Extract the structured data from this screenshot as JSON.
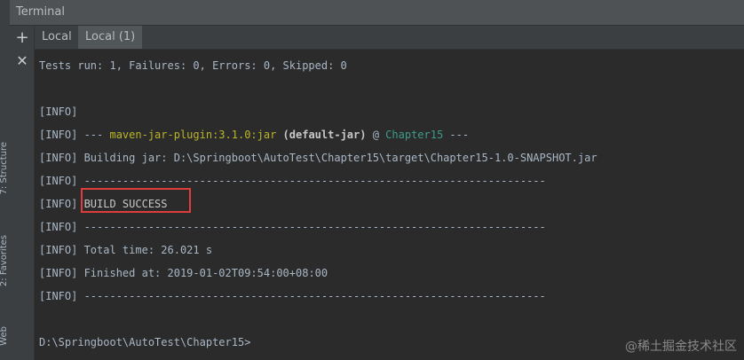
{
  "window": {
    "title": "Terminal"
  },
  "side_strip": {
    "labels": [
      "7: Structure",
      "2: Favorites",
      "Web"
    ]
  },
  "tabs": [
    {
      "label": "Local",
      "active": false
    },
    {
      "label": "Local (1)",
      "active": true
    }
  ],
  "toolbar": {
    "add_icon": "plus-icon",
    "close_icon": "close-icon"
  },
  "terminal": {
    "tests_line": "Tests run: 1, Failures: 0, Errors: 0, Skipped: 0",
    "lines": [
      {
        "tag": "[INFO]",
        "text": ""
      },
      {
        "tag": "[INFO]",
        "pre": " --- ",
        "plugin": "maven-jar-plugin:3.1.0:jar",
        "mid": " (default-jar)",
        "at": " @ ",
        "project": "Chapter15",
        "post": " ---"
      },
      {
        "tag": "[INFO]",
        "text": " Building jar: D:\\Springboot\\AutoTest\\Chapter15\\target\\Chapter15-1.0-SNAPSHOT.jar"
      },
      {
        "tag": "[INFO]",
        "text": " ------------------------------------------------------------------------"
      },
      {
        "tag": "[INFO]",
        "text": " BUILD SUCCESS"
      },
      {
        "tag": "[INFO]",
        "text": " ------------------------------------------------------------------------"
      },
      {
        "tag": "[INFO]",
        "text": " Total time: 26.021 s"
      },
      {
        "tag": "[INFO]",
        "text": " Finished at: 2019-01-02T09:54:00+08:00"
      },
      {
        "tag": "[INFO]",
        "text": " ------------------------------------------------------------------------"
      }
    ],
    "prompt": "D:\\Springboot\\AutoTest\\Chapter15>"
  },
  "watermark": "@稀土掘金技术社区",
  "colors": {
    "background": "#2b2b2b",
    "selection": "#214283",
    "plugin_yellow": "#bbb529",
    "project_green": "#3c9b8a",
    "annotation_red": "#e03c3c"
  }
}
